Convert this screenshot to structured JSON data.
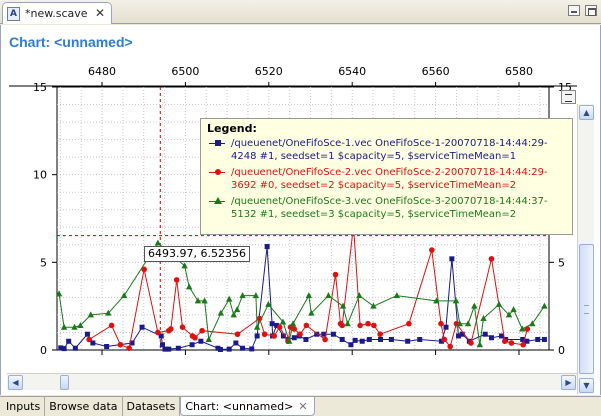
{
  "editor_tab": {
    "icon": "A",
    "label": "*new.scave",
    "close": "✕"
  },
  "page_title": "Chart: <unnamed>",
  "cursor_readout": "6493.97, 6.52356",
  "legend": {
    "title": "Legend:",
    "items": [
      {
        "label": "/queuenet/OneFifoSce-1.vec OneFifoSce-1-20070718-14:44:29-4248 #1, seedset=1 $capacity=5, $serviceTimeMean=1",
        "color": "#1a1a8c",
        "marker": "square"
      },
      {
        "label": "/queuenet/OneFifoSce-2.vec OneFifoSce-2-20070718-14:44:29-3692 #0, seedset=2 $capacity=5, $serviceTimeMean=2",
        "color": "#e01010",
        "marker": "circle"
      },
      {
        "label": "/queuenet/OneFifoSce-3.vec OneFifoSce-3-20070718-14:44:37-5132 #1, seedset=3 $capacity=5, $serviceTimeMean=2",
        "color": "#1a7a1a",
        "marker": "triangle"
      }
    ]
  },
  "bottom_tabs": [
    {
      "label": "Inputs",
      "active": false
    },
    {
      "label": "Browse data",
      "active": false
    },
    {
      "label": "Datasets",
      "active": false
    },
    {
      "label": "Chart: <unnamed>",
      "active": true,
      "close": "✕"
    }
  ],
  "chart_data": {
    "type": "line",
    "xlim": [
      6469.2,
      6587.2
    ],
    "ylim": [
      0,
      15
    ],
    "x_ticks": [
      6480,
      6500,
      6520,
      6540,
      6560,
      6580
    ],
    "y_ticks_left": [
      0,
      5,
      10,
      15
    ],
    "y_ticks_right": [
      0,
      5,
      10,
      15
    ],
    "grid": true,
    "crosshair": {
      "x": 6493.97,
      "y": 6.52356
    },
    "series": [
      {
        "color": "#1a1a8c",
        "marker": "square",
        "points": [
          [
            6470.1,
            0.12
          ],
          [
            6470.9,
            0.08
          ],
          [
            6472.0,
            0.5
          ],
          [
            6473.6,
            0.1
          ],
          [
            6476.5,
            0.9
          ],
          [
            6477.8,
            0.4
          ],
          [
            6481.1,
            0.2
          ],
          [
            6487.2,
            0.4
          ],
          [
            6489.6,
            1.3
          ],
          [
            6494.2,
            0.8
          ],
          [
            6494.5,
            0.3
          ],
          [
            6495.1,
            0.05
          ],
          [
            6496.0,
            0.05
          ],
          [
            6498.3,
            0.1
          ],
          [
            6501.6,
            0.3
          ],
          [
            6503.7,
            0.5
          ],
          [
            6507.8,
            0.1
          ],
          [
            6508.4,
            0.03
          ],
          [
            6510.5,
            0.05
          ],
          [
            6512.1,
            0.4
          ],
          [
            6513.7,
            0.1
          ],
          [
            6515.9,
            0.06
          ],
          [
            6517.2,
            0.8
          ],
          [
            6519.6,
            5.9
          ],
          [
            6520.8,
            1.5
          ],
          [
            6520.9,
            0.8
          ],
          [
            6521.9,
            1.4
          ],
          [
            6523.5,
            0.8
          ],
          [
            6524.6,
            0.6
          ],
          [
            6526.1,
            0.7
          ],
          [
            6527.3,
            0.8
          ],
          [
            6528.9,
            0.6
          ],
          [
            6531.5,
            0.9
          ],
          [
            6533.2,
            0.9
          ],
          [
            6535.5,
            0.9
          ],
          [
            6537.6,
            0.6
          ],
          [
            6539.7,
            0.3
          ],
          [
            6540.7,
            0.55
          ],
          [
            6542.4,
            0.5
          ],
          [
            6544.1,
            0.6
          ],
          [
            6546.8,
            0.6
          ],
          [
            6549.4,
            0.6
          ],
          [
            6553.3,
            0.5
          ],
          [
            6556.2,
            0.6
          ],
          [
            6561.4,
            0.5
          ],
          [
            6562.5,
            1.3
          ],
          [
            6563.9,
            5.2
          ],
          [
            6565.5,
            0.8
          ],
          [
            6566.4,
            0.9
          ],
          [
            6568.1,
            0.5
          ],
          [
            6571.9,
            0.9
          ],
          [
            6573.4,
            0.7
          ],
          [
            6575.8,
            0.8
          ],
          [
            6576.8,
            0.6
          ],
          [
            6580.9,
            0.6
          ],
          [
            6581.9,
            0.5
          ],
          [
            6584.5,
            0.6
          ],
          [
            6586.1,
            0.6
          ]
        ]
      },
      {
        "color": "#e01010",
        "marker": "circle",
        "points": [
          [
            6476.9,
            0.6
          ],
          [
            6482.3,
            1.4
          ],
          [
            6484.4,
            0.3
          ],
          [
            6486.5,
            0.1
          ],
          [
            6490.1,
            4.6
          ],
          [
            6493.4,
            1.0
          ],
          [
            6496.0,
            1.1
          ],
          [
            6496.5,
            1.2
          ],
          [
            6497.9,
            4.0
          ],
          [
            6499.3,
            1.3
          ],
          [
            6501.7,
            0.8
          ],
          [
            6502.3,
            0.7
          ],
          [
            6504.0,
            1.1
          ],
          [
            6512.5,
            0.9
          ],
          [
            6517.8,
            1.8
          ],
          [
            6519.0,
            0.9
          ],
          [
            6521.3,
            0.8
          ],
          [
            6522.6,
            1.3
          ],
          [
            6524.6,
            0.5
          ],
          [
            6525.2,
            1.3
          ],
          [
            6526.1,
            1.2
          ],
          [
            6527.5,
            0.9
          ],
          [
            6529.0,
            1.4
          ],
          [
            6533.5,
            0.6
          ],
          [
            6536.0,
            4.3
          ],
          [
            6537.2,
            1.5
          ],
          [
            6537.6,
            1.4
          ],
          [
            6540.3,
            7.1
          ],
          [
            6541.9,
            1.4
          ],
          [
            6543.8,
            1.5
          ],
          [
            6545.2,
            1.4
          ],
          [
            6546.7,
            0.9
          ],
          [
            6553.6,
            1.5
          ],
          [
            6559.1,
            5.7
          ],
          [
            6561.3,
            1.5
          ],
          [
            6562.1,
            0.6
          ],
          [
            6563.5,
            0.2
          ],
          [
            6565.0,
            1.5
          ],
          [
            6568.5,
            0.4
          ],
          [
            6573.4,
            5.2
          ],
          [
            6576.6,
            0.5
          ],
          [
            6578.2,
            0.4
          ],
          [
            6581.0,
            0.3
          ],
          [
            6582.0,
            1.2
          ]
        ]
      },
      {
        "color": "#1a7a1a",
        "marker": "triangle",
        "points": [
          [
            6469.7,
            3.2
          ],
          [
            6470.9,
            1.3
          ],
          [
            6473.4,
            1.3
          ],
          [
            6474.8,
            1.4
          ],
          [
            6477.3,
            2.0
          ],
          [
            6481.5,
            2.1
          ],
          [
            6485.3,
            3.1
          ],
          [
            6493.4,
            6.1
          ],
          [
            6499.8,
            4.8
          ],
          [
            6500.9,
            3.6
          ],
          [
            6503.0,
            2.8
          ],
          [
            6504.6,
            2.8
          ],
          [
            6505.6,
            0.6
          ],
          [
            6508.5,
            2.1
          ],
          [
            6510.5,
            2.9
          ],
          [
            6511.6,
            2.0
          ],
          [
            6512.4,
            2.3
          ],
          [
            6513.7,
            3.1
          ],
          [
            6516.9,
            3.1
          ],
          [
            6517.2,
            1.3
          ],
          [
            6519.9,
            2.6
          ],
          [
            6523.4,
            1.6
          ],
          [
            6524.9,
            0.5
          ],
          [
            6525.8,
            1.5
          ],
          [
            6529.6,
            3.1
          ],
          [
            6530.2,
            2.1
          ],
          [
            6534.3,
            3.1
          ],
          [
            6537.8,
            2.5
          ],
          [
            6538.9,
            1.5
          ],
          [
            6541.7,
            3.1
          ],
          [
            6545.1,
            2.5
          ],
          [
            6550.7,
            3.1
          ],
          [
            6560.2,
            2.8
          ],
          [
            6564.9,
            2.8
          ],
          [
            6565.8,
            1.5
          ],
          [
            6567.8,
            1.5
          ],
          [
            6569.3,
            2.5
          ],
          [
            6570.6,
            0.3
          ],
          [
            6571.5,
            1.8
          ],
          [
            6575.2,
            2.6
          ],
          [
            6577.6,
            2.0
          ],
          [
            6578.7,
            2.3
          ],
          [
            6580.8,
            1.2
          ],
          [
            6583.2,
            1.5
          ],
          [
            6586.1,
            2.5
          ]
        ]
      }
    ]
  }
}
